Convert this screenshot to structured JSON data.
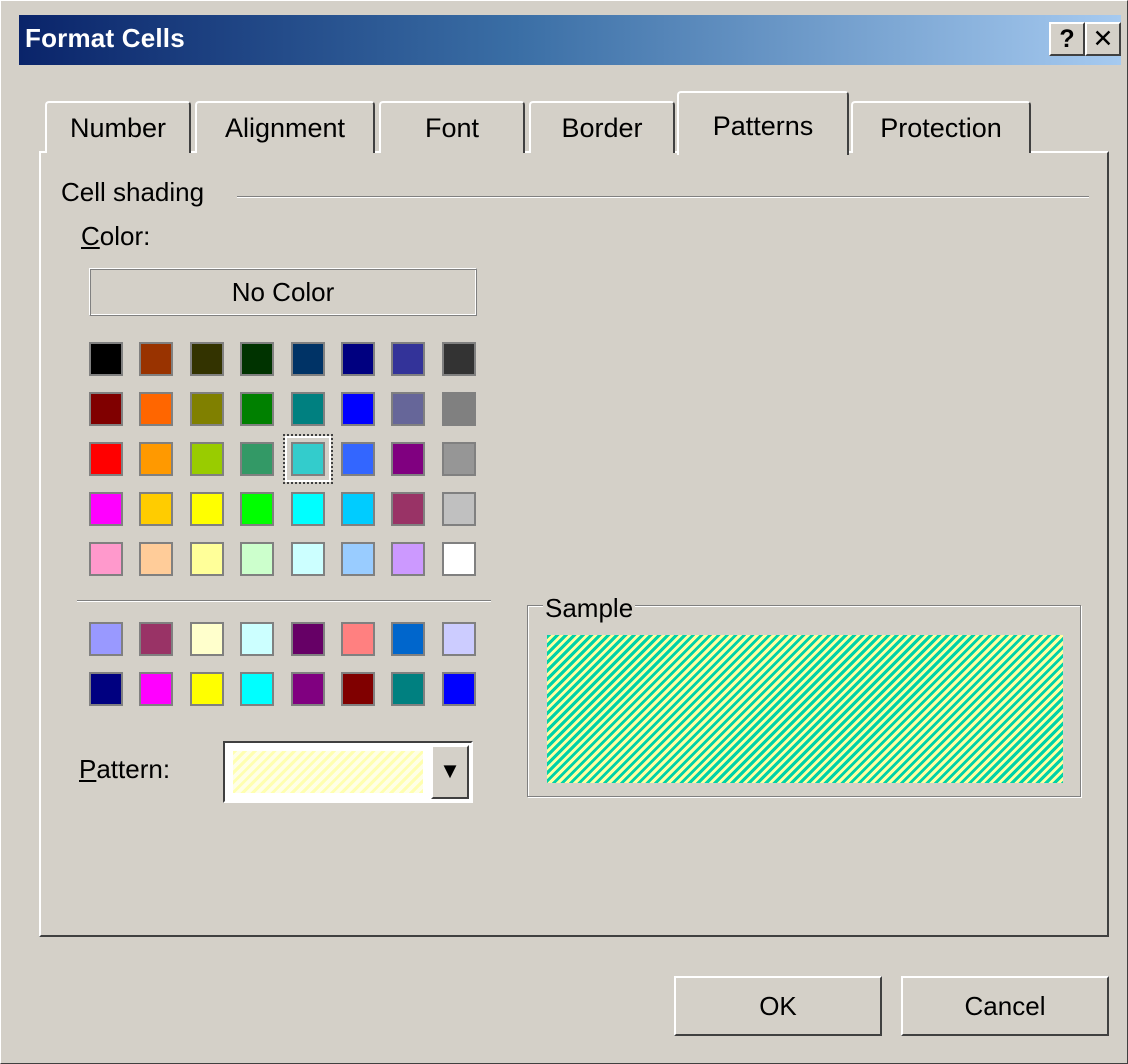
{
  "window": {
    "title": "Format Cells",
    "help_label": "?",
    "close_label": "✕"
  },
  "tabs": [
    {
      "label": "Number"
    },
    {
      "label": "Alignment"
    },
    {
      "label": "Font"
    },
    {
      "label": "Border"
    },
    {
      "label": "Patterns",
      "active": true
    },
    {
      "label": "Protection"
    }
  ],
  "cell_shading": {
    "group_label": "Cell shading",
    "color_label_prefix": "C",
    "color_label_rest": "olor:",
    "no_color_label": "No Color",
    "palette_main": [
      "#000000",
      "#993300",
      "#333300",
      "#003300",
      "#003366",
      "#000080",
      "#333399",
      "#333333",
      "#800000",
      "#ff6600",
      "#808000",
      "#008000",
      "#008080",
      "#0000ff",
      "#666699",
      "#808080",
      "#ff0000",
      "#ff9900",
      "#99cc00",
      "#339966",
      "#33cccc",
      "#3366ff",
      "#800080",
      "#969696",
      "#ff00ff",
      "#ffcc00",
      "#ffff00",
      "#00ff00",
      "#00ffff",
      "#00ccff",
      "#993366",
      "#c0c0c0",
      "#ff99cc",
      "#ffcc99",
      "#ffff99",
      "#ccffcc",
      "#ccffff",
      "#99ccff",
      "#cc99ff",
      "#ffffff"
    ],
    "palette_extra": [
      "#9999ff",
      "#993366",
      "#ffffcc",
      "#ccffff",
      "#660066",
      "#ff8080",
      "#0066cc",
      "#ccccff",
      "#000080",
      "#ff00ff",
      "#ffff00",
      "#00ffff",
      "#800080",
      "#800000",
      "#008080",
      "#0000ff"
    ],
    "selected_color": "#33cccc",
    "pattern_label_prefix": "P",
    "pattern_label_rest": "attern:",
    "pattern_value": "light diagonal stripe (yellow)"
  },
  "sample": {
    "label": "Sample",
    "colors": [
      "#00d2a8",
      "#ffffa0"
    ]
  },
  "buttons": {
    "ok": "OK",
    "cancel": "Cancel"
  }
}
